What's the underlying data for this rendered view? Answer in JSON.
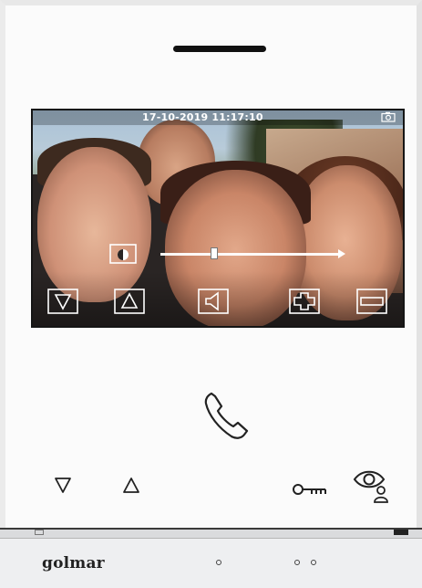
{
  "screen": {
    "datetime": "17-10-2019  11:17:10",
    "brightness_level": 0.3,
    "controls": [
      {
        "name": "down",
        "icon": "triangle-down-icon"
      },
      {
        "name": "up",
        "icon": "triangle-up-icon"
      },
      {
        "name": "volume",
        "icon": "speaker-icon"
      },
      {
        "name": "plus",
        "icon": "plus-icon"
      },
      {
        "name": "minus",
        "icon": "minus-icon"
      }
    ]
  },
  "panel_buttons": {
    "answer": "phone-handset-icon",
    "down": "triangle-down-icon",
    "up": "triangle-up-icon",
    "door": "key-icon",
    "monitor": "eye-user-icon"
  },
  "brand": {
    "logo": "golmar"
  },
  "colors": {
    "body": "#f6f7f8",
    "screen_frame": "#151515",
    "icon_stroke": "#222222",
    "overlay_icon": "#ffffff"
  }
}
